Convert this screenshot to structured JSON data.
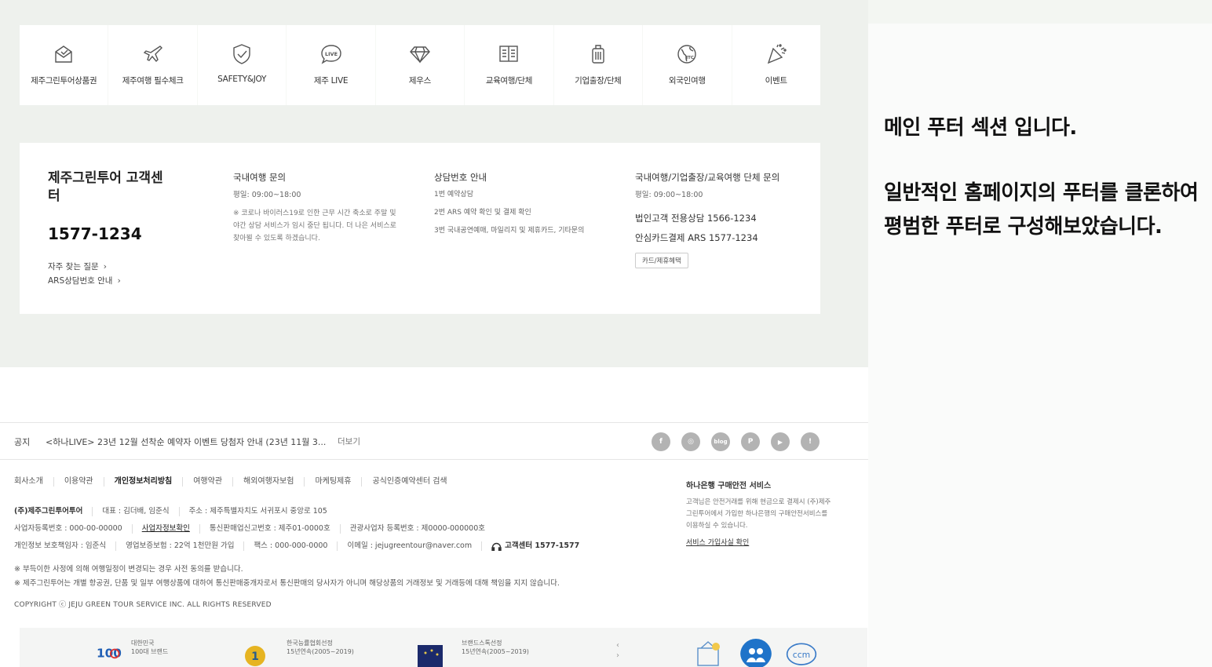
{
  "categories": [
    {
      "label": "제주그린투어상품권",
      "icon": "envelope-icon"
    },
    {
      "label": "제주여행 필수체크",
      "icon": "airplane-icon"
    },
    {
      "label": "SAFETY&JOY",
      "icon": "shield-icon"
    },
    {
      "label": "제주 LIVE",
      "icon": "live-chat-icon"
    },
    {
      "label": "제우스",
      "icon": "diamond-icon"
    },
    {
      "label": "교육여행/단체",
      "icon": "book-icon"
    },
    {
      "label": "기업출장/단체",
      "icon": "luggage-icon"
    },
    {
      "label": "외국인여행",
      "icon": "globe-icon"
    },
    {
      "label": "이벤트",
      "icon": "party-icon"
    }
  ],
  "customer_center": {
    "title": "제주그린투어 고객센터",
    "phone": "1577-1234",
    "links": [
      "자주 찾는 질문",
      "ARS상담번호 안내"
    ],
    "domestic": {
      "title": "국내여행 문의",
      "hours": "평일: 09:00~18:00",
      "notice": "※ 코로나 바이러스19로 인한 근무 시간 축소로 주말 및 야간 상담 서비스가 임시 중단 됩니다. 더 나은 서비스로 찾아뵐 수 있도록 하겠습니다."
    },
    "consult": {
      "title": "상담번호 안내",
      "items": [
        "1번 예약상담",
        "2번 ARS 예약 확인 및 결제 확인",
        "3번 국내공연예매, 마일리지 및 제휴카드, 기타문의"
      ]
    },
    "corporate": {
      "title": "국내여행/기업출장/교육여행 단체 문의",
      "hours": "평일: 09:00~18:00",
      "lines": [
        "법인고객 전용상담 1566-1234",
        "안심카드결제 ARS 1577-1234"
      ],
      "button": "카드/제휴혜택"
    }
  },
  "notice": {
    "label": "공지",
    "text": "<하나LIVE> 23년 12월 선착순 예약자 이벤트 당첨자 안내 (23년 11월 3...",
    "more": "더보기"
  },
  "sns": [
    {
      "name": "facebook-icon",
      "glyph": "f"
    },
    {
      "name": "instagram-icon",
      "glyph": "◎"
    },
    {
      "name": "blog-icon",
      "glyph": "blog"
    },
    {
      "name": "post-icon",
      "glyph": "P"
    },
    {
      "name": "youtube-icon",
      "glyph": "▶"
    },
    {
      "name": "story-icon",
      "glyph": "!"
    }
  ],
  "footer_links": [
    {
      "label": "회사소개",
      "bold": false
    },
    {
      "label": "이용약관",
      "bold": false
    },
    {
      "label": "개인정보처리방침",
      "bold": true
    },
    {
      "label": "여행약관",
      "bold": false
    },
    {
      "label": "해외여행자보험",
      "bold": false
    },
    {
      "label": "마케팅제휴",
      "bold": false
    },
    {
      "label": "공식인증예약센터 검색",
      "bold": false
    }
  ],
  "company_info": {
    "row1": [
      "(주)제주그린투어투어",
      "대표 : 김더배, 임준식",
      "주소 : 제주특별자치도 서귀포시 중앙로 105"
    ],
    "row2": [
      "사업자등록번호 : 000-00-00000",
      "사업자정보확인",
      "통신판매업신고번호 : 제주01-0000호",
      "관광사업자 등록번호 : 제0000-000000호"
    ],
    "row3": [
      "개인정보 보호책임자 : 임준식",
      "영업보증보험 : 22억 1천만원 가입",
      "팩스 : 000-000-0000",
      "이메일 : jejugreentour@naver.com"
    ],
    "center": "고객센터 1577-1577"
  },
  "disclaimers": [
    "※ 부득이한 사정에 의해 여행일정이 변경되는 경우 사전 동의를 받습니다.",
    "※ 제주그린투어는 개별 항공권, 단품 및 일부 여행상품에 대하여 통신판매중개자로서 통신판매의 당사자가 아니며 해당상품의 거래정보 및 거래등에 대해 책임을 지지 않습니다."
  ],
  "copyright": "COPYRIGHT ⓒ JEJU GREEN TOUR SERVICE INC. ALL RIGHTS RESERVED",
  "bank": {
    "title": "하나은행 구매안전 서비스",
    "text": "고객님은 안전거래를 위해 현금으로 결제시 (주)제주그린투어에서 가입한 하나은행의 구매안전서비스를 이용하실 수 있습니다.",
    "link": "서비스 가입사실 확인"
  },
  "awards": [
    {
      "line1": "대한민국",
      "line2": "100대 브랜드"
    },
    {
      "line1": "한국능률협회선정",
      "line2": "15년연속(2005~2019)"
    },
    {
      "line1": "브랜드스톡선정",
      "line2": "15년연속(2005~2019)"
    }
  ],
  "award_nav": {
    "prev": "‹",
    "next": "›"
  },
  "certs": [
    "cert-tour-icon",
    "cert-people-icon",
    "ccm-icon"
  ],
  "cert_ccm_text": "ccm",
  "award_badge": "1",
  "award_logo_text": "100",
  "side_note": {
    "line1": "메인 푸터 섹션 입니다.",
    "line2": "일반적인 홈페이지의 푸터를 클론하여",
    "line3": "평범한 푸터로 구성해보았습니다."
  },
  "colors": {
    "panel_bg": "#eef1ed",
    "sns_gray": "#b3b3b3",
    "cert_blue": "#1f73c9"
  }
}
